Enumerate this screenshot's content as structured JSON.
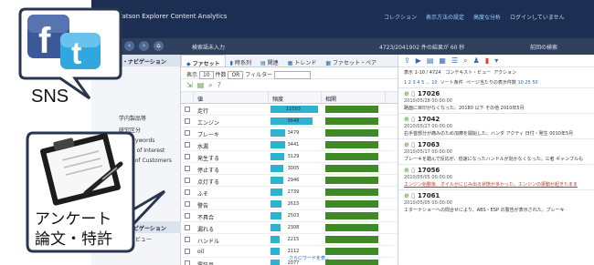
{
  "app": {
    "title": "IBM Watson Explorer Content Analytics",
    "header_links": [
      "コレクション",
      "表示方法の設定",
      "高度な分析"
    ],
    "login_link": "ログインしていません"
  },
  "address": {
    "path": "検索語未入力",
    "stats": "4723/2041902 件の結果が 60 秒",
    "search_option": "前回の検索"
  },
  "facet": {
    "header": "ファセット・ナビゲーション",
    "items": [
      "学内製品等",
      "研究区分",
      "My Keywords",
      "Terms of Interest",
      "Voice of Customers"
    ],
    "bottom_header": "ファセット・ナビゲーション",
    "bottom_item": "コンテキスト・ビュー"
  },
  "tabs": [
    "ファセット",
    "時系列",
    "関連",
    "トレンド",
    "ファセット・ペア"
  ],
  "toolbar": {
    "table_label": "表示",
    "table_value": "10",
    "count_label": "件数",
    "count_value": "OR",
    "filter_label": "フィルター",
    "filter_placeholder": ""
  },
  "table": {
    "headers": [
      "値",
      "頻度",
      "相関"
    ],
    "more_link": "さらにワードを表..."
  },
  "chart_data": {
    "type": "table",
    "columns": [
      "値",
      "頻度",
      "相関"
    ],
    "rows": [
      {
        "value": "走行",
        "freq": 11003
      },
      {
        "value": "エンジン",
        "freq": 9648
      },
      {
        "value": "ブレーキ",
        "freq": 3479
      },
      {
        "value": "水漏",
        "freq": 3441
      },
      {
        "value": "発生する",
        "freq": 3129
      },
      {
        "value": "停止する",
        "freq": 3005
      },
      {
        "value": "点灯する",
        "freq": 2946
      },
      {
        "value": "ふそ",
        "freq": 2739
      },
      {
        "value": "警告",
        "freq": 2615
      },
      {
        "value": "不具合",
        "freq": 2503
      },
      {
        "value": "漏れる",
        "freq": 2308
      },
      {
        "value": "ハンドル",
        "freq": 2215
      },
      {
        "value": "oil",
        "freq": 2112
      },
      {
        "value": "電装品",
        "freq": 2077
      }
    ],
    "max_freq": 11003
  },
  "docs": {
    "info_label": "表示 1-10 / 4724",
    "pager": "1 2 3 4 5 ... 10",
    "sort_label": "ソート条件",
    "view_label": "コンテキスト・ビュー",
    "action_label": "アクション",
    "pages_label": "ページ当たりの表示件数",
    "page_sizes": "10 25 50",
    "items": [
      {
        "id": "17026",
        "date": "2010/05/28 00:00:00",
        "text": "路面に目印がなくなった。20180 以下 その他 2010年5月"
      },
      {
        "id": "17042",
        "date": "2010/05/27 00:00:00",
        "text": "右手首部分が痛みのため加療を開始した。ハンダ アクティ 日付・発生 0010年5月"
      },
      {
        "id": "17063",
        "date": "2010/05/17 00:00:00",
        "text": "ブレーキを踏んで反応が、低速になったハンドルが効かなくなった。三者 ギャンブルも"
      },
      {
        "id": "17056",
        "date": "2010/05/05 00:00:00",
        "text": "エンジン始動後、オイルがにじみ出る状態が多かった。エンジンの振動が起きたまま",
        "highlight": true
      },
      {
        "id": "17061",
        "date": "2010/05/05 00:00:00",
        "text": "エターナショーへの問合せにより、ABS・ESP の警告が表示された。ブレーキ"
      }
    ]
  },
  "overlay": {
    "sns_label": "SNS",
    "photo_line1": "アンケート",
    "photo_line2": "論文・特許"
  },
  "colors": {
    "titlebar": "#1c2e52",
    "freq_bar": "#2bb3d0",
    "corr_bar": "#3f8a26",
    "facebook": "#3b5998",
    "twitter": "#31a7e0"
  }
}
